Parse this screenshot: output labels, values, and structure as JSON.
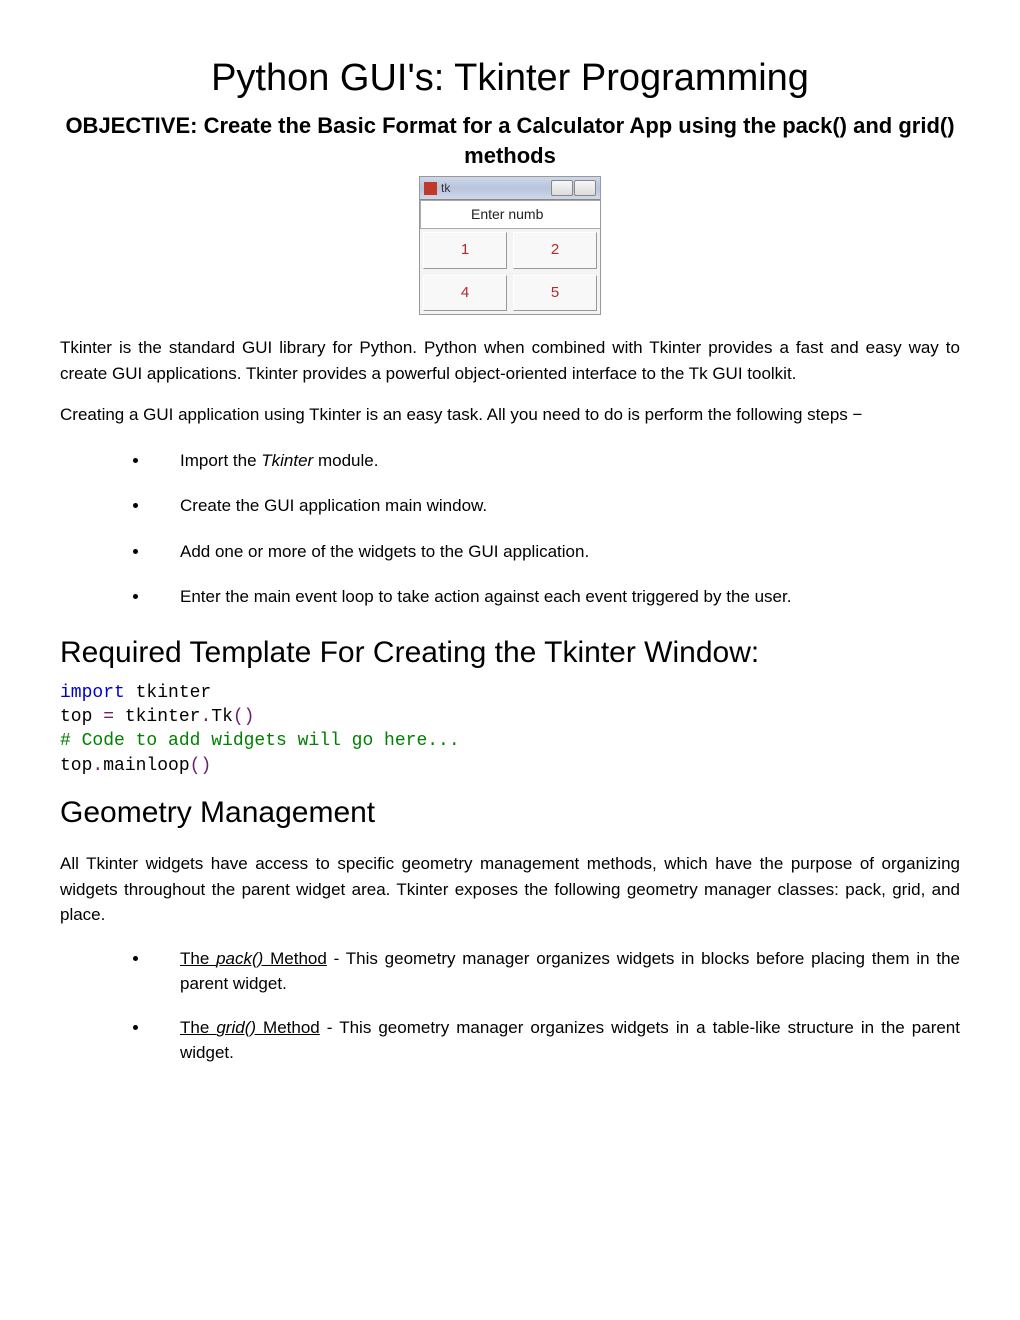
{
  "title": "Python GUI's: Tkinter Programming",
  "objective": "OBJECTIVE: Create the Basic Format for a Calculator App using the pack() and grid() methods",
  "tkwin": {
    "title": "tk",
    "entry": "Enter numb",
    "btn1": "1",
    "btn2": "2",
    "btn4": "4",
    "btn5": "5"
  },
  "para1": "Tkinter is the standard GUI library for Python. Python when combined with Tkinter provides a fast and easy way to create GUI applications. Tkinter provides a powerful object-oriented interface to the Tk GUI toolkit.",
  "para2": "Creating a GUI application using Tkinter is an easy task. All you need to do is perform the following steps −",
  "steps": {
    "s1a": "Import the ",
    "s1b": "Tkinter",
    "s1c": " module.",
    "s2": "Create the GUI application main window.",
    "s3": "Add one or more of the widgets to the GUI application.",
    "s4": "Enter the main event loop to take action against each event triggered by the user."
  },
  "section_template": "Required Template For Creating the Tkinter Window:",
  "code": {
    "l1a": "import",
    "l1b": " tkinter",
    "l2a": "top ",
    "l2b": "=",
    "l2c": " tkinter",
    "l2d": ".",
    "l2e": "Tk",
    "l2f": "()",
    "l3": "# Code to add widgets will go here...",
    "l4a": "top",
    "l4b": ".",
    "l4c": "mainloop",
    "l4d": "()"
  },
  "section_geometry": "Geometry Management",
  "geom_intro": "All Tkinter widgets have access to specific geometry management methods, which have the purpose of organizing widgets throughout the parent widget area. Tkinter exposes the following geometry manager classes: pack, grid, and place.",
  "geom": {
    "pack_label_pre": "The ",
    "pack_label_em": "pack()",
    "pack_label_post": " Method",
    "pack_desc": " - This geometry manager organizes widgets in blocks before placing them in the parent widget.",
    "grid_label_pre": "The ",
    "grid_label_em": "grid()",
    "grid_label_post": " Method",
    "grid_desc": " - This geometry manager organizes widgets in a table-like structure in the parent widget."
  }
}
